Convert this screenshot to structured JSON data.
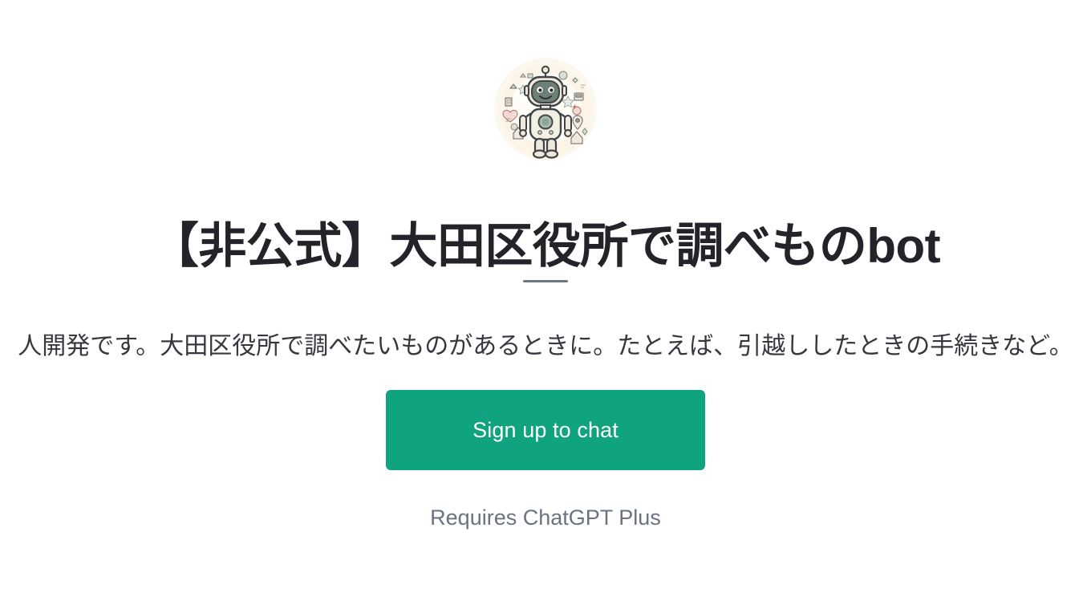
{
  "page": {
    "background_color": "#ffffff"
  },
  "avatar": {
    "icon": "robot-avatar-icon",
    "alt": "robot avatar",
    "background_color": "#fdfaf3",
    "body_color": "#efe9db",
    "outline_color": "#3f4448",
    "face_color": "#6d7f77",
    "accent_color": "#7f938a"
  },
  "header": {
    "title": "【非公式】大田区役所で調べものbot",
    "title_color": "#22242a",
    "divider_color": "#6e7682"
  },
  "description": {
    "text": "人開発です。大田区役所で調べたいものがあるときに。たとえば、引越ししたときの手続きなど。",
    "color": "#35383f"
  },
  "cta": {
    "label": "Sign up to chat",
    "background_color": "#10a37f",
    "text_color": "#ffffff"
  },
  "footnote": {
    "text": "Requires ChatGPT Plus",
    "color": "#6b7280"
  }
}
